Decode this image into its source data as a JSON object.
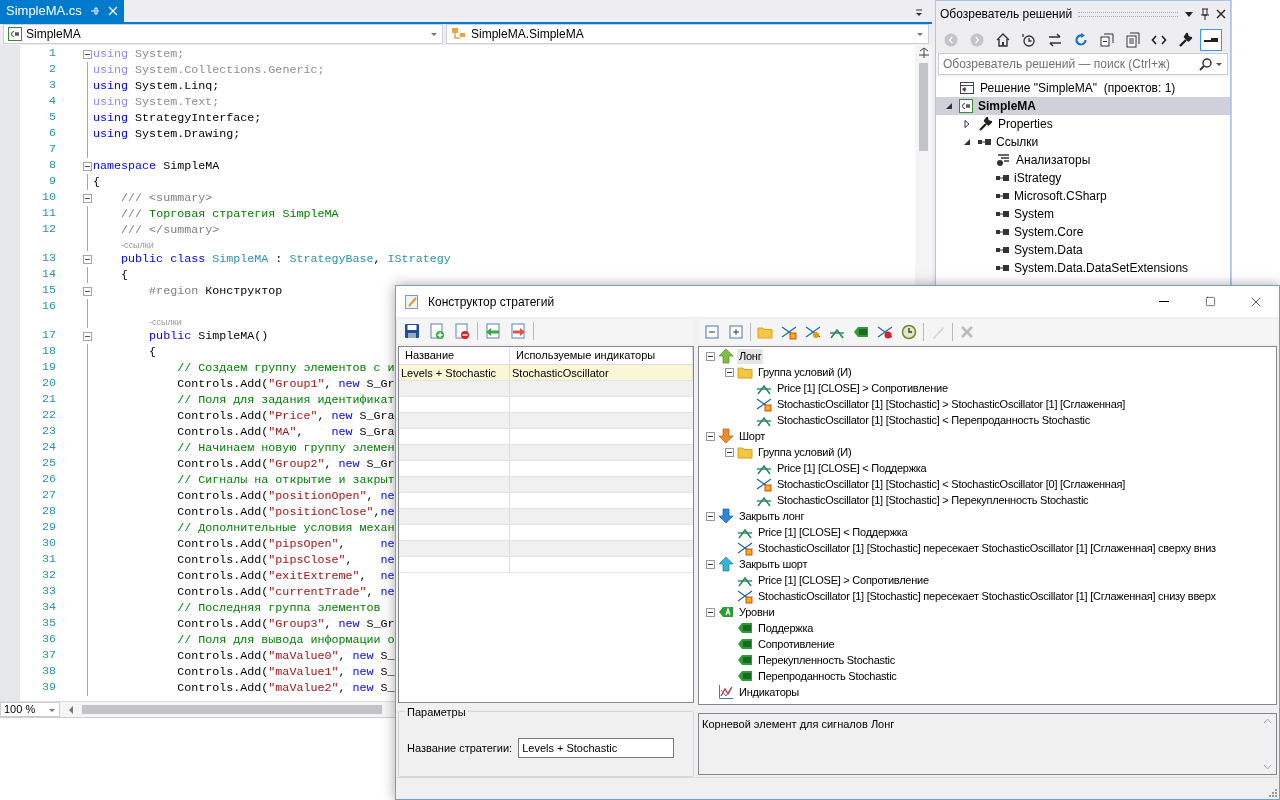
{
  "editor": {
    "tab": {
      "label": "SimpleMA.cs",
      "selected": true
    },
    "nav": [
      {
        "kind": "csharp",
        "text": "SimpleMA"
      },
      {
        "kind": "class",
        "text": "SimpleMA.SimpleMA"
      }
    ],
    "zoom": "100 %",
    "lines": [
      {
        "kind": "code",
        "num": "1",
        "fold": true,
        "tokens": [
          {
            "kind": "dimkw",
            "text": "using"
          },
          {
            "kind": "dim",
            "text": " System;"
          }
        ]
      },
      {
        "kind": "code",
        "num": "2",
        "fold": false,
        "tokens": [
          {
            "kind": "dimkw",
            "text": "using"
          },
          {
            "kind": "dim",
            "text": " System.Collections.Generic;"
          }
        ]
      },
      {
        "kind": "code",
        "num": "3",
        "fold": false,
        "tokens": [
          {
            "kind": "kw",
            "text": "using"
          },
          {
            "kind": "pl",
            "text": " System.Linq;"
          }
        ]
      },
      {
        "kind": "code",
        "num": "4",
        "fold": false,
        "tokens": [
          {
            "kind": "dimkw",
            "text": "using"
          },
          {
            "kind": "dim",
            "text": " System.Text;"
          }
        ]
      },
      {
        "kind": "code",
        "num": "5",
        "fold": false,
        "tokens": [
          {
            "kind": "kw",
            "text": "using"
          },
          {
            "kind": "pl",
            "text": " StrategyInterface;"
          }
        ]
      },
      {
        "kind": "code",
        "num": "6",
        "fold": false,
        "tokens": [
          {
            "kind": "kw",
            "text": "using"
          },
          {
            "kind": "pl",
            "text": " System.Drawing;"
          }
        ]
      },
      {
        "kind": "code",
        "num": "7",
        "fold": false
      },
      {
        "kind": "code",
        "num": "8",
        "fold": true,
        "tokens": [
          {
            "kind": "kw",
            "text": "namespace"
          },
          {
            "kind": "pl",
            "text": " SimpleMA"
          }
        ]
      },
      {
        "kind": "code",
        "num": "9",
        "fold": false,
        "tokens": [
          {
            "kind": "pl",
            "text": "{"
          }
        ]
      },
      {
        "kind": "code",
        "num": "10",
        "fold": true,
        "tokens": [
          {
            "kind": "doc",
            "text": "    /// <summary>"
          }
        ]
      },
      {
        "kind": "code",
        "num": "11",
        "fold": false,
        "tokens": [
          {
            "kind": "doc",
            "text": "    ///"
          },
          {
            "kind": "cm",
            "text": " Торговая стратегия SimpleMA"
          }
        ]
      },
      {
        "kind": "code",
        "num": "12",
        "fold": false,
        "tokens": [
          {
            "kind": "doc",
            "text": "    /// </summary>"
          }
        ]
      },
      {
        "kind": "lens",
        "text": "-ссылки"
      },
      {
        "kind": "code",
        "num": "13",
        "fold": true,
        "tokens": [
          {
            "kind": "kw",
            "text": "    public class"
          },
          {
            "kind": "ty",
            "text": " SimpleMA"
          },
          {
            "kind": "pl",
            "text": " : "
          },
          {
            "kind": "ty",
            "text": "StrategyBase"
          },
          {
            "kind": "pl",
            "text": ", "
          },
          {
            "kind": "ty",
            "text": "IStrategy"
          }
        ]
      },
      {
        "kind": "code",
        "num": "14",
        "fold": false,
        "tokens": [
          {
            "kind": "pl",
            "text": "    {"
          }
        ]
      },
      {
        "kind": "code",
        "num": "15",
        "fold": true,
        "tokens": [
          {
            "kind": "doc",
            "text": "        #region"
          },
          {
            "kind": "pl",
            "text": " Конструктор"
          }
        ]
      },
      {
        "kind": "code",
        "num": "16",
        "fold": false
      },
      {
        "kind": "lens",
        "text": "-ссылки"
      },
      {
        "kind": "code",
        "num": "17",
        "fold": true,
        "tokens": [
          {
            "kind": "kw",
            "text": "        public"
          },
          {
            "kind": "pl",
            "text": " SimpleMA()"
          }
        ]
      },
      {
        "kind": "code",
        "num": "18",
        "fold": false,
        "tokens": [
          {
            "kind": "pl",
            "text": "        {"
          }
        ]
      },
      {
        "kind": "code",
        "num": "19",
        "fold": false,
        "tokens": [
          {
            "kind": "cm",
            "text": "            // Создаем группу элементов с и"
          }
        ]
      },
      {
        "kind": "code",
        "num": "20",
        "fold": false,
        "tokens": [
          {
            "kind": "pl",
            "text": "            Controls.Add("
          },
          {
            "kind": "str",
            "text": "\"Group1\""
          },
          {
            "kind": "pl",
            "text": ", "
          },
          {
            "kind": "kw",
            "text": "new"
          },
          {
            "kind": "pl",
            "text": " S_Gr"
          }
        ]
      },
      {
        "kind": "code",
        "num": "21",
        "fold": false,
        "tokens": [
          {
            "kind": "cm",
            "text": "            // Поля для задания идентификат"
          }
        ]
      },
      {
        "kind": "code",
        "num": "22",
        "fold": false,
        "tokens": [
          {
            "kind": "pl",
            "text": "            Controls.Add("
          },
          {
            "kind": "str",
            "text": "\"Price\""
          },
          {
            "kind": "pl",
            "text": ", "
          },
          {
            "kind": "kw",
            "text": "new"
          },
          {
            "kind": "pl",
            "text": " S_Gra"
          }
        ]
      },
      {
        "kind": "code",
        "num": "23",
        "fold": false,
        "tokens": [
          {
            "kind": "pl",
            "text": "            Controls.Add("
          },
          {
            "kind": "str",
            "text": "\"MA\""
          },
          {
            "kind": "pl",
            "text": ",    "
          },
          {
            "kind": "kw",
            "text": "new"
          },
          {
            "kind": "pl",
            "text": " S_Gra"
          }
        ]
      },
      {
        "kind": "code",
        "num": "24",
        "fold": false,
        "tokens": [
          {
            "kind": "cm",
            "text": "            // Начинаем новую группу элемен"
          }
        ]
      },
      {
        "kind": "code",
        "num": "25",
        "fold": false,
        "tokens": [
          {
            "kind": "pl",
            "text": "            Controls.Add("
          },
          {
            "kind": "str",
            "text": "\"Group2\""
          },
          {
            "kind": "pl",
            "text": ", "
          },
          {
            "kind": "kw",
            "text": "new"
          },
          {
            "kind": "pl",
            "text": " S_Gr"
          }
        ]
      },
      {
        "kind": "code",
        "num": "26",
        "fold": false,
        "tokens": [
          {
            "kind": "cm",
            "text": "            // Сигналы на открытие и закрыт"
          }
        ]
      },
      {
        "kind": "code",
        "num": "27",
        "fold": false,
        "tokens": [
          {
            "kind": "pl",
            "text": "            Controls.Add("
          },
          {
            "kind": "str",
            "text": "\"positionOpen\""
          },
          {
            "kind": "pl",
            "text": ", "
          },
          {
            "kind": "kw",
            "text": "ne"
          }
        ]
      },
      {
        "kind": "code",
        "num": "28",
        "fold": false,
        "tokens": [
          {
            "kind": "pl",
            "text": "            Controls.Add("
          },
          {
            "kind": "str",
            "text": "\"positionClose\""
          },
          {
            "kind": "pl",
            "text": ","
          },
          {
            "kind": "kw",
            "text": "ne"
          }
        ]
      },
      {
        "kind": "code",
        "num": "29",
        "fold": false,
        "tokens": [
          {
            "kind": "cm",
            "text": "            // Дополнительные условия механ"
          }
        ]
      },
      {
        "kind": "code",
        "num": "30",
        "fold": false,
        "tokens": [
          {
            "kind": "pl",
            "text": "            Controls.Add("
          },
          {
            "kind": "str",
            "text": "\"pipsOpen\""
          },
          {
            "kind": "pl",
            "text": ",     "
          },
          {
            "kind": "kw",
            "text": "ne"
          }
        ]
      },
      {
        "kind": "code",
        "num": "31",
        "fold": false,
        "tokens": [
          {
            "kind": "pl",
            "text": "            Controls.Add("
          },
          {
            "kind": "str",
            "text": "\"pipsClose\""
          },
          {
            "kind": "pl",
            "text": ",    "
          },
          {
            "kind": "kw",
            "text": "ne"
          }
        ]
      },
      {
        "kind": "code",
        "num": "32",
        "fold": false,
        "tokens": [
          {
            "kind": "pl",
            "text": "            Controls.Add("
          },
          {
            "kind": "str",
            "text": "\"exitExtreme\""
          },
          {
            "kind": "pl",
            "text": ",  "
          },
          {
            "kind": "kw",
            "text": "ne"
          }
        ]
      },
      {
        "kind": "code",
        "num": "33",
        "fold": false,
        "tokens": [
          {
            "kind": "pl",
            "text": "            Controls.Add("
          },
          {
            "kind": "str",
            "text": "\"currentTrade\""
          },
          {
            "kind": "pl",
            "text": ", "
          },
          {
            "kind": "kw",
            "text": "ne"
          }
        ]
      },
      {
        "kind": "code",
        "num": "34",
        "fold": false,
        "tokens": [
          {
            "kind": "cm",
            "text": "            // Последняя группа элементов"
          }
        ]
      },
      {
        "kind": "code",
        "num": "35",
        "fold": false,
        "tokens": [
          {
            "kind": "pl",
            "text": "            Controls.Add("
          },
          {
            "kind": "str",
            "text": "\"Group3\""
          },
          {
            "kind": "pl",
            "text": ", "
          },
          {
            "kind": "kw",
            "text": "new"
          },
          {
            "kind": "pl",
            "text": " S_Gr"
          }
        ]
      },
      {
        "kind": "code",
        "num": "36",
        "fold": false,
        "tokens": [
          {
            "kind": "cm",
            "text": "            // Поля для вывода информации о"
          }
        ]
      },
      {
        "kind": "code",
        "num": "37",
        "fold": false,
        "tokens": [
          {
            "kind": "pl",
            "text": "            Controls.Add("
          },
          {
            "kind": "str",
            "text": "\"maValue0\""
          },
          {
            "kind": "pl",
            "text": ", "
          },
          {
            "kind": "kw",
            "text": "new"
          },
          {
            "kind": "pl",
            "text": " S_"
          }
        ]
      },
      {
        "kind": "code",
        "num": "38",
        "fold": false,
        "tokens": [
          {
            "kind": "pl",
            "text": "            Controls.Add("
          },
          {
            "kind": "str",
            "text": "\"maValue1\""
          },
          {
            "kind": "pl",
            "text": ", "
          },
          {
            "kind": "kw",
            "text": "new"
          },
          {
            "kind": "pl",
            "text": " S_"
          }
        ]
      },
      {
        "kind": "code",
        "num": "39",
        "fold": false,
        "tokens": [
          {
            "kind": "pl",
            "text": "            Controls.Add("
          },
          {
            "kind": "str",
            "text": "\"maValue2\""
          },
          {
            "kind": "pl",
            "text": ", "
          },
          {
            "kind": "kw",
            "text": "new"
          },
          {
            "kind": "pl",
            "text": " S_"
          }
        ]
      }
    ]
  },
  "solution_explorer": {
    "title": "Обозреватель решений",
    "toolbar": [
      {
        "kind": "back",
        "disabled": true,
        "selected": false
      },
      {
        "kind": "forward",
        "disabled": true,
        "selected": false
      },
      {
        "kind": "home",
        "disabled": false,
        "selected": false
      },
      {
        "kind": "history",
        "disabled": false,
        "selected": false
      },
      {
        "kind": "sync",
        "disabled": false,
        "selected": false
      },
      {
        "kind": "refresh",
        "disabled": false,
        "selected": false
      },
      {
        "kind": "collapse",
        "disabled": false,
        "selected": false
      },
      {
        "kind": "copy",
        "disabled": false,
        "selected": false
      },
      {
        "kind": "code",
        "disabled": false,
        "selected": false
      },
      {
        "kind": "wrench",
        "disabled": false,
        "selected": false
      },
      {
        "kind": "preview",
        "disabled": false,
        "selected": true
      }
    ],
    "search": {
      "placeholder": "Обозреватель решений — поиск (Ctrl+ж)"
    },
    "tree": [
      {
        "label": "Решение \"SimpleMA\"  (проектов: 1)",
        "kind": "solution",
        "selected": false,
        "bold": false
      },
      {
        "label": "SimpleMA",
        "kind": "csharp",
        "selected": true,
        "bold": true,
        "expanded": true,
        "children": [
          {
            "label": "Properties",
            "kind": "wrench",
            "selected": false,
            "bold": false,
            "expanded": false
          },
          {
            "label": "Ссылки",
            "kind": "ref",
            "selected": false,
            "bold": false,
            "expanded": true,
            "children": [
              {
                "label": "Анализаторы",
                "kind": "analyzer",
                "selected": false,
                "bold": false
              },
              {
                "label": "iStrategy",
                "kind": "ref",
                "selected": false,
                "bold": false
              },
              {
                "label": "Microsoft.CSharp",
                "kind": "ref",
                "selected": false,
                "bold": false
              },
              {
                "label": "System",
                "kind": "ref",
                "selected": false,
                "bold": false
              },
              {
                "label": "System.Core",
                "kind": "ref",
                "selected": false,
                "bold": false
              },
              {
                "label": "System.Data",
                "kind": "ref",
                "selected": false,
                "bold": false
              },
              {
                "label": "System.Data.DataSetExtensions",
                "kind": "ref",
                "selected": false,
                "bold": false
              }
            ]
          }
        ]
      }
    ]
  },
  "dialog": {
    "title": "Конструктор стратегий",
    "left_toolbar": [
      {
        "kind": "save",
        "disabled": false
      },
      {
        "kind": "add",
        "disabled": false
      },
      {
        "kind": "remove",
        "disabled": false
      },
      {
        "kind": "import",
        "disabled": false
      },
      {
        "kind": "export",
        "disabled": false
      }
    ],
    "table": {
      "columns": [
        "Название",
        "Используемые индикаторы"
      ],
      "rows": [
        {
          "cells": [
            "Levels + Stochastic",
            "StochasticOscillator"
          ],
          "selected": true
        }
      ]
    },
    "right_toolbar": [
      {
        "kind": "collapse",
        "disabled": false
      },
      {
        "kind": "expand",
        "disabled": false
      },
      {
        "kind": "folder",
        "disabled": false
      },
      {
        "kind": "cross",
        "disabled": false
      },
      {
        "kind": "cross2",
        "disabled": false
      },
      {
        "kind": "line",
        "disabled": false
      },
      {
        "kind": "tagadd",
        "disabled": false
      },
      {
        "kind": "crossadd",
        "disabled": false
      },
      {
        "kind": "clock",
        "disabled": false
      },
      {
        "kind": "pencil",
        "disabled": true
      },
      {
        "kind": "delete",
        "disabled": true
      }
    ],
    "tree": [
      {
        "label": "Лонг",
        "kind": "long",
        "selected": true,
        "expanded": true,
        "children": [
          {
            "label": "Группа условий (И)",
            "kind": "group",
            "selected": false,
            "expanded": true,
            "children": [
              {
                "label": "Price [1] [CLOSE] > Сопротивление",
                "kind": "line",
                "selected": false
              },
              {
                "label": "StochasticOscillator [1] [Stochastic] > StochasticOscillator [1] [Сглаженная]",
                "kind": "cross",
                "selected": false
              },
              {
                "label": "StochasticOscillator [1] [Stochastic] < Перепроданность Stochastic",
                "kind": "line",
                "selected": false
              }
            ]
          }
        ]
      },
      {
        "label": "Шорт",
        "kind": "short",
        "selected": false,
        "expanded": true,
        "children": [
          {
            "label": "Группа условий (И)",
            "kind": "group",
            "selected": false,
            "expanded": true,
            "children": [
              {
                "label": "Price [1] [CLOSE] < Поддержка",
                "kind": "line",
                "selected": false
              },
              {
                "label": "StochasticOscillator [1] [Stochastic] < StochasticOscillator [0] [Сглаженная]",
                "kind": "cross",
                "selected": false
              },
              {
                "label": "StochasticOscillator [1] [Stochastic] > Перекупленность Stochastic",
                "kind": "line",
                "selected": false
              }
            ]
          }
        ]
      },
      {
        "label": "Закрыть лонг",
        "kind": "exitlong",
        "selected": false,
        "expanded": true,
        "children": [
          {
            "label": "Price [1] [CLOSE] < Поддержка",
            "kind": "line",
            "selected": false
          },
          {
            "label": "StochasticOscillator [1] [Stochastic] пересекает StochasticOscillator [1] [Сглаженная] сверху вниз",
            "kind": "cross",
            "selected": false
          }
        ]
      },
      {
        "label": "Закрыть шорт",
        "kind": "exitshort",
        "selected": false,
        "expanded": true,
        "children": [
          {
            "label": "Price [1] [CLOSE] > Сопротивление",
            "kind": "line",
            "selected": false
          },
          {
            "label": "StochasticOscillator [1] [Stochastic] пересекает StochasticOscillator [1] [Сглаженная] снизу вверх",
            "kind": "cross",
            "selected": false
          }
        ]
      },
      {
        "label": "Уровни",
        "kind": "levels",
        "selected": false,
        "expanded": true,
        "children": [
          {
            "label": "Поддержка",
            "kind": "level",
            "selected": false
          },
          {
            "label": "Сопротивление",
            "kind": "level",
            "selected": false
          },
          {
            "label": "Перекупленность Stochastic",
            "kind": "level",
            "selected": false
          },
          {
            "label": "Перепроданность Stochastic",
            "kind": "level",
            "selected": false
          }
        ]
      },
      {
        "label": "Индикаторы",
        "kind": "indicators",
        "selected": false
      }
    ],
    "params": {
      "legend": "Параметры",
      "label": "Название стратегии:",
      "value": "Levels + Stochastic"
    },
    "description": "Корневой элемент для сигналов Лонг"
  }
}
